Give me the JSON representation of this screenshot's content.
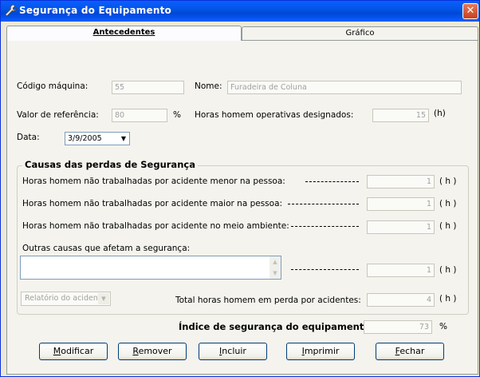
{
  "window": {
    "title": "Segurança do Equipamento",
    "close_glyph": "✕"
  },
  "tabs": [
    {
      "label": "Antecedentes",
      "active": true
    },
    {
      "label": "Gráfico",
      "active": false
    }
  ],
  "form": {
    "codigo_label": "Código máquina:",
    "codigo_value": "55",
    "nome_label": "Nome:",
    "nome_value": "Furadeira de Coluna",
    "valor_label": "Valor de referência:",
    "valor_value": "80",
    "percent": "%",
    "horas_op_label": "Horas homem operativas designados:",
    "horas_op_value": "15",
    "unit_h": "(h)",
    "data_label": "Data:",
    "data_value": "3/9/2005"
  },
  "causes": {
    "title": "Causas das perdas de Segurança",
    "rows": [
      {
        "label": "Horas homem não trabalhadas por acidente menor na pessoa:",
        "value": "1",
        "unit": "( h )"
      },
      {
        "label": "Horas homem não trabalhadas por acidente maior na pessoa:",
        "value": "1",
        "unit": "( h )"
      },
      {
        "label": "Horas homem não trabalhadas por acidente no meio ambiente:",
        "value": "1",
        "unit": "( h )"
      }
    ],
    "outras_label": "Outras causas que afetam a segurança:",
    "outras_text": "",
    "outras_value": "1",
    "outras_unit": "( h )",
    "relatorio_value": "Relatório do acidente",
    "total_label": "Total horas homem em perda por acidentes:",
    "total_value": "4",
    "total_unit": "( h )"
  },
  "indice": {
    "label": "Índice de segurança do equipamento:",
    "value": "73",
    "unit": "%"
  },
  "buttons": {
    "modificar": {
      "key": "M",
      "rest": "odificar"
    },
    "remover": {
      "key": "R",
      "rest": "emover"
    },
    "incluir": {
      "key": "I",
      "rest": "ncluir"
    },
    "imprimir": {
      "key": "I",
      "rest": "mprimir"
    },
    "fechar": {
      "key": "F",
      "rest": "echar"
    }
  }
}
